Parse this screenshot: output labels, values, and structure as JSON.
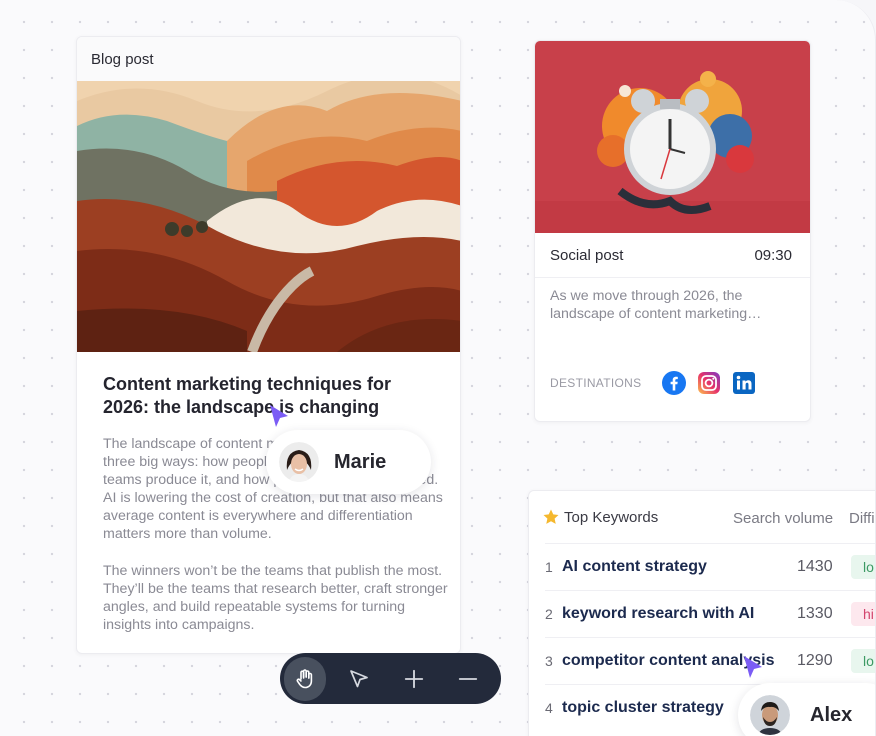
{
  "blog_card": {
    "header": "Blog post",
    "title": "Content marketing techniques for 2026: the landscape is changing",
    "paragraphs": [
      "The landscape of content marketing is changing in three big ways: how people discover content, how teams produce it, and how performance is measured. AI is lowering the cost of creation, but that also means average content is everywhere and differentiation matters more than volume.",
      "The winners won’t be the teams that publish the most. They’ll be the teams that research better, craft stronger angles, and build repeatable systems for turning insights into campaigns."
    ]
  },
  "social_card": {
    "header": "Social post",
    "time": "09:30",
    "text": "As we move through 2026, the landscape of content marketing…",
    "destinations_label": "DESTINATIONS",
    "destinations": [
      "facebook-icon",
      "instagram-icon",
      "linkedin-icon"
    ]
  },
  "keywords_card": {
    "title": "Top Keywords",
    "col_volume": "Search volume",
    "col_difficulty": "Diffi",
    "rows": [
      {
        "num": "1",
        "keyword": "AI content strategy",
        "volume": "1430",
        "badge": "lo",
        "badge_color": "#e8f6ee",
        "badge_text_color": "#3c9a64"
      },
      {
        "num": "2",
        "keyword": "keyword research with AI",
        "volume": "1330",
        "badge": "hi",
        "badge_color": "#fde8ee",
        "badge_text_color": "#d2456e"
      },
      {
        "num": "3",
        "keyword": "competitor content analysis",
        "volume": "1290",
        "badge": "lo",
        "badge_color": "#e8f6ee",
        "badge_text_color": "#3c9a64"
      },
      {
        "num": "4",
        "keyword": "topic cluster strategy",
        "volume": "",
        "badge": "",
        "badge_color": "#ffffff",
        "badge_text_color": "#ffffff"
      }
    ]
  },
  "toolbar": {
    "tools": [
      "hand-tool-icon",
      "pointer-tool-icon",
      "zoom-in-icon",
      "zoom-out-icon"
    ],
    "active_tool": "hand-tool-icon"
  },
  "collaborators": [
    {
      "name": "Marie",
      "cursor_color": "#7b5cf5"
    },
    {
      "name": "Alex",
      "cursor_color": "#7b5cf5"
    }
  ]
}
